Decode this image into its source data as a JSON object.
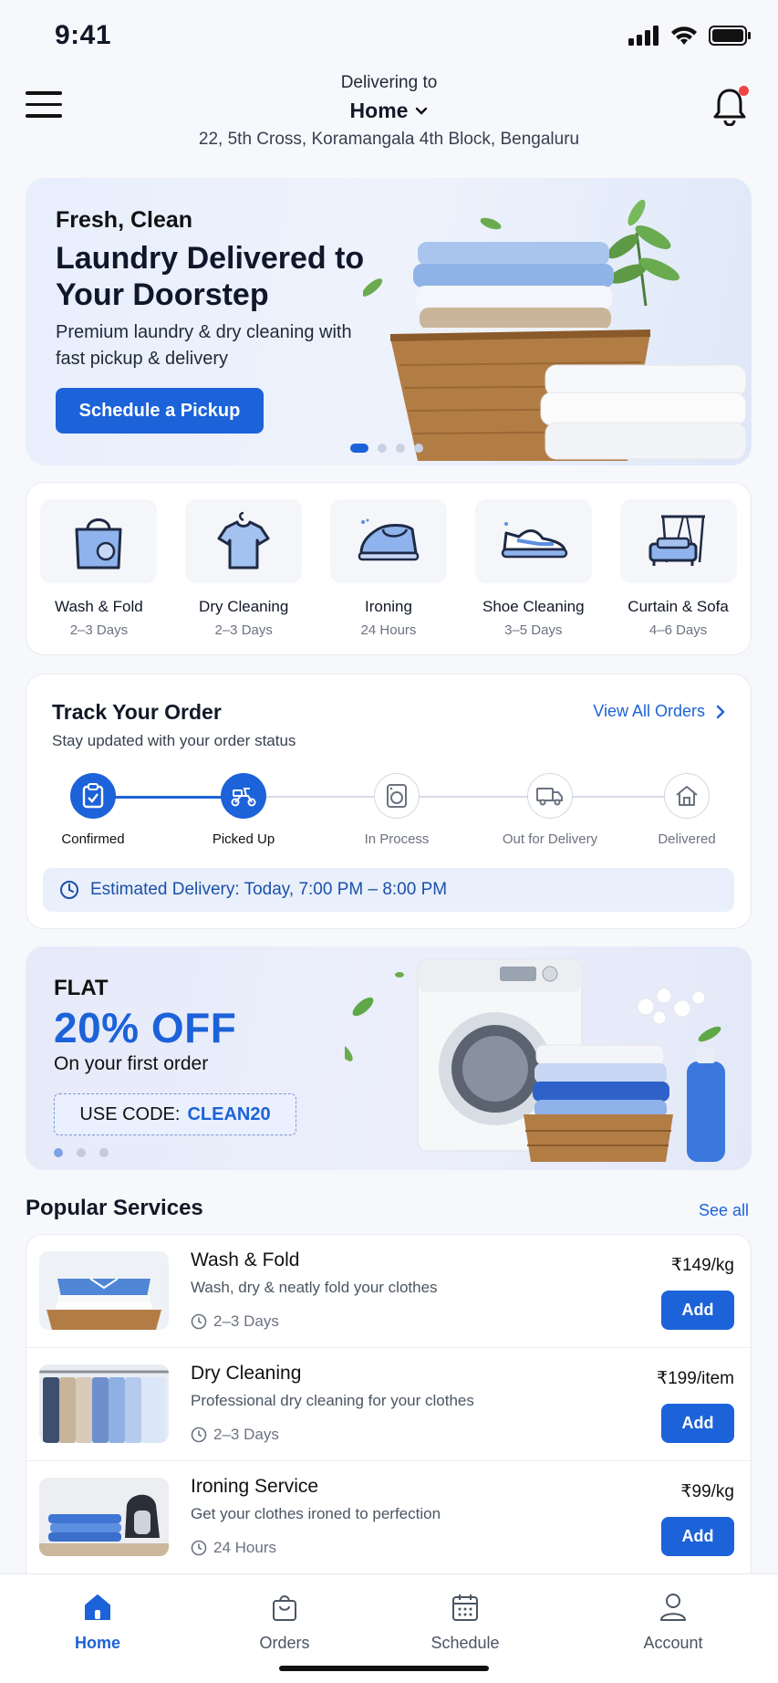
{
  "status_bar": {
    "time": "9:41"
  },
  "header": {
    "deliver_label": "Delivering to",
    "location_name": "Home",
    "address": "22, 5th Cross, Koramangala 4th Block, Bengaluru"
  },
  "hero": {
    "subtitle": "Fresh, Clean",
    "title": "Laundry Delivered to Your Doorstep",
    "description": "Premium laundry & dry cleaning with fast pickup & delivery",
    "cta": "Schedule a Pickup",
    "slide_count": 4,
    "active_slide": 1
  },
  "categories": [
    {
      "name": "Wash & Fold",
      "duration": "2–3 Days",
      "icon": "shopping-bag-icon"
    },
    {
      "name": "Dry Cleaning",
      "duration": "2–3 Days",
      "icon": "tshirt-hanger-icon"
    },
    {
      "name": "Ironing",
      "duration": "24 Hours",
      "icon": "iron-icon"
    },
    {
      "name": "Shoe Cleaning",
      "duration": "3–5 Days",
      "icon": "sneaker-icon"
    },
    {
      "name": "Curtain & Sofa",
      "duration": "4–6 Days",
      "icon": "sofa-curtain-icon"
    }
  ],
  "track": {
    "title": "Track Your Order",
    "subtitle": "Stay updated with your order status",
    "link": "View All Orders",
    "steps": [
      {
        "label": "Confirmed",
        "done": true,
        "icon": "clipboard-check-icon"
      },
      {
        "label": "Picked Up",
        "done": true,
        "icon": "scooter-icon"
      },
      {
        "label": "In Process",
        "done": false,
        "icon": "washing-machine-icon"
      },
      {
        "label": "Out for Delivery",
        "done": false,
        "icon": "truck-icon"
      },
      {
        "label": "Delivered",
        "done": false,
        "icon": "home-icon"
      }
    ],
    "eta": "Estimated Delivery: Today, 7:00 PM – 8:00 PM"
  },
  "promo": {
    "flat": "FLAT",
    "discount": "20% OFF",
    "description": "On your first order",
    "code_label": "USE CODE:",
    "code": "CLEAN20",
    "slide_count": 3,
    "active_slide": 1
  },
  "popular": {
    "title": "Popular Services",
    "see_all": "See all",
    "items": [
      {
        "name": "Wash & Fold",
        "description": "Wash, dry & neatly fold your clothes",
        "duration": "2–3 Days",
        "price": "₹149/kg",
        "add": "Add"
      },
      {
        "name": "Dry Cleaning",
        "description": "Professional dry cleaning for your clothes",
        "duration": "2–3 Days",
        "price": "₹199/item",
        "add": "Add"
      },
      {
        "name": "Ironing Service",
        "description": "Get your clothes ironed to perfection",
        "duration": "24 Hours",
        "price": "₹99/kg",
        "add": "Add"
      }
    ]
  },
  "bottom_nav": [
    {
      "label": "Home",
      "active": true,
      "icon": "home-icon"
    },
    {
      "label": "Orders",
      "active": false,
      "icon": "shopping-bag-icon"
    },
    {
      "label": "Schedule",
      "active": false,
      "icon": "calendar-icon"
    },
    {
      "label": "Account",
      "active": false,
      "icon": "user-icon"
    }
  ],
  "colors": {
    "accent": "#1c62d9",
    "badge": "#ef4444",
    "background": "#f7f8fb"
  }
}
